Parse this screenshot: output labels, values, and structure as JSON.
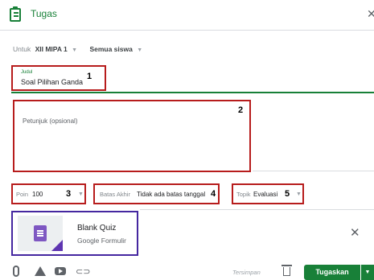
{
  "header": {
    "title": "Tugas",
    "close": "✕",
    "icon": "assignment-icon"
  },
  "for_row": {
    "for_label": "Untuk",
    "class_value": "XII MIPA 1",
    "students_value": "Semua siswa"
  },
  "title_field": {
    "label": "Judul",
    "value": "Soal Pilihan Ganda"
  },
  "instructions_field": {
    "placeholder": "Petunjuk (opsional)"
  },
  "points": {
    "label": "Poin",
    "value": "100"
  },
  "due": {
    "label": "Batas Akhir",
    "value": "Tidak ada batas tanggal"
  },
  "topic": {
    "label": "Topik",
    "value": "Evaluasi"
  },
  "annotations": [
    "1",
    "2",
    "3",
    "4",
    "5"
  ],
  "attachment": {
    "name": "Blank Quiz",
    "type": "Google Formulir",
    "icon": "google-forms-icon",
    "remove": "✕"
  },
  "toolbar": {
    "icons": [
      "paperclip-icon",
      "drive-icon",
      "youtube-icon",
      "link-icon"
    ],
    "saved_text": "Tersimpan",
    "assign_label": "Tugaskan",
    "dropdown": "▼"
  },
  "colors": {
    "accent": "#188038",
    "annotation_red": "#b71c1c",
    "annotation_purple": "#4527a0"
  }
}
